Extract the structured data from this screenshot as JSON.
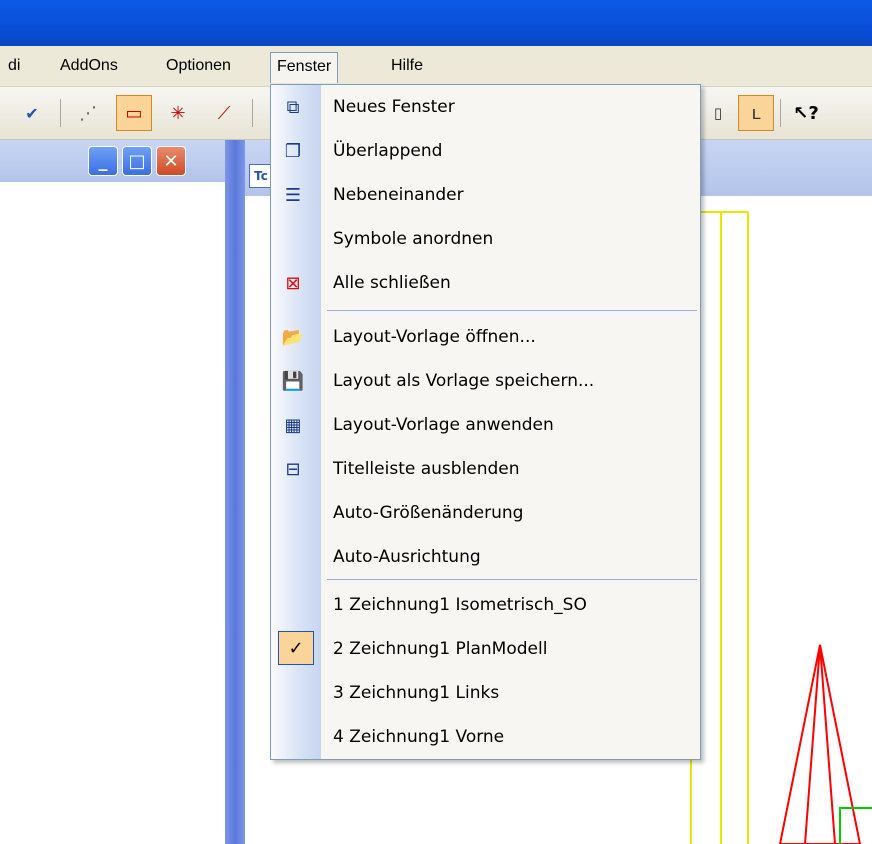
{
  "menubar": {
    "items": [
      {
        "label": "di"
      },
      {
        "label": "AddOns"
      },
      {
        "label": "Optionen"
      },
      {
        "label": "Fenster"
      },
      {
        "label": "Hilfe"
      }
    ]
  },
  "window": {
    "tab_icon_text": "Tc"
  },
  "menu": {
    "items": [
      {
        "label": "Neues Fenster",
        "icon": "new-window-icon"
      },
      {
        "label": "Überlappend",
        "icon": "cascade-icon"
      },
      {
        "label": "Nebeneinander",
        "icon": "tile-icon"
      },
      {
        "label": "Symbole anordnen",
        "icon": ""
      },
      {
        "label": "Alle schließen",
        "icon": "close-all-icon"
      },
      {
        "label": "Layout-Vorlage öffnen...",
        "icon": "open-template-icon"
      },
      {
        "label": "Layout als Vorlage speichern...",
        "icon": "save-template-icon"
      },
      {
        "label": "Layout-Vorlage anwenden",
        "icon": "apply-template-icon"
      },
      {
        "label": "Titelleiste ausblenden",
        "icon": "hide-titlebar-icon"
      },
      {
        "label": "Auto-Größenänderung",
        "icon": ""
      },
      {
        "label": "Auto-Ausrichtung",
        "icon": ""
      },
      {
        "label": "1 Zeichnung1 Isometrisch_SO",
        "icon": ""
      },
      {
        "label": "2 Zeichnung1 PlanModell",
        "icon": "check-icon",
        "checked": true
      },
      {
        "label": "3 Zeichnung1 Links",
        "icon": ""
      },
      {
        "label": "4 Zeichnung1 Vorne",
        "icon": ""
      }
    ]
  },
  "colors": {
    "titlebar": "#0a4ed8",
    "menu_border": "#7f9db9",
    "check_bg": "#fbd49a",
    "drawing_yellow": "#ffff00",
    "drawing_red": "#ff0000",
    "drawing_green": "#00cc00"
  }
}
